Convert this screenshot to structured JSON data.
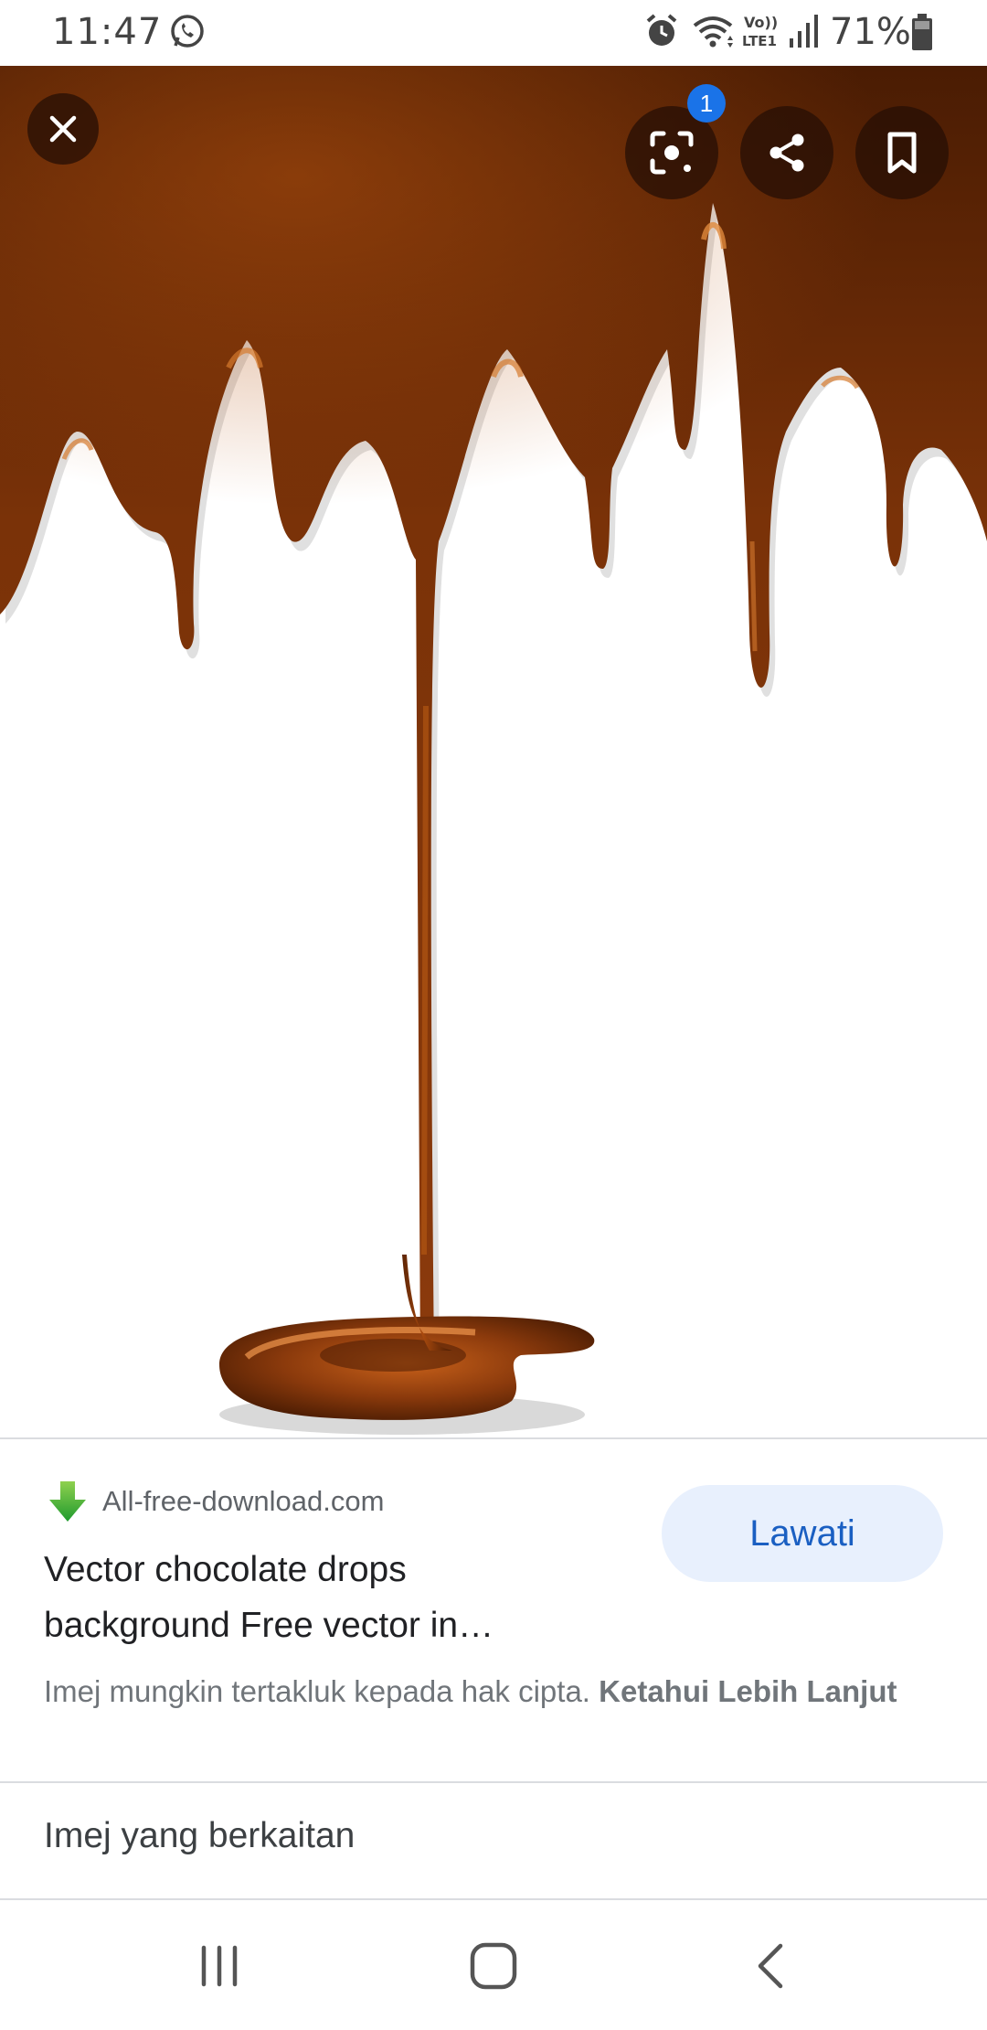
{
  "status_bar": {
    "time": "11:47",
    "battery": "71%",
    "icons": [
      "whatsapp-icon",
      "alarm-icon",
      "wifi-icon",
      "volte-lte-icon",
      "signal-icon",
      "battery-icon"
    ]
  },
  "viewer": {
    "lens_badge_count": "1",
    "buttons": [
      "close-icon",
      "lens-icon",
      "share-icon",
      "bookmark-icon"
    ],
    "image_colors": {
      "chocolate_dark": "#4a1c03",
      "chocolate_mid": "#8b3a0c",
      "chocolate_light": "#c8611a"
    }
  },
  "result": {
    "source": "All-free-download.com",
    "visit_label": "Lawati",
    "title": "Vector chocolate drops background Free vector in…",
    "copyright_text": "Imej mungkin tertakluk kepada hak cipta.",
    "learn_more": "Ketahui Lebih Lanjut"
  },
  "related": {
    "label": "Imej yang berkaitan"
  },
  "nav_bar": {
    "buttons": [
      "recents-icon",
      "home-icon",
      "back-icon"
    ]
  },
  "colors": {
    "accent": "#1a73e8",
    "visit_bg": "#e8f0fd",
    "visit_text": "#1a5fc2"
  }
}
